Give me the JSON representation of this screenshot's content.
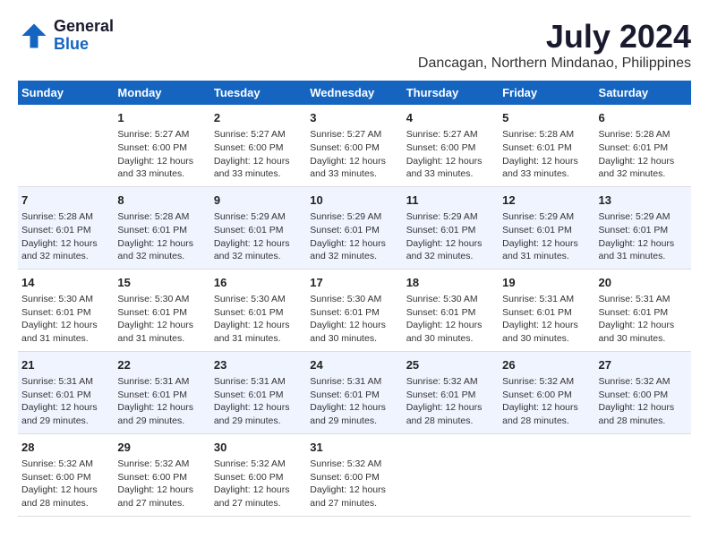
{
  "logo": {
    "line1": "General",
    "line2": "Blue"
  },
  "title": "July 2024",
  "subtitle": "Dancagan, Northern Mindanao, Philippines",
  "weekdays": [
    "Sunday",
    "Monday",
    "Tuesday",
    "Wednesday",
    "Thursday",
    "Friday",
    "Saturday"
  ],
  "weeks": [
    [
      {
        "day": "",
        "sunrise": "",
        "sunset": "",
        "daylight": ""
      },
      {
        "day": "1",
        "sunrise": "Sunrise: 5:27 AM",
        "sunset": "Sunset: 6:00 PM",
        "daylight": "Daylight: 12 hours and 33 minutes."
      },
      {
        "day": "2",
        "sunrise": "Sunrise: 5:27 AM",
        "sunset": "Sunset: 6:00 PM",
        "daylight": "Daylight: 12 hours and 33 minutes."
      },
      {
        "day": "3",
        "sunrise": "Sunrise: 5:27 AM",
        "sunset": "Sunset: 6:00 PM",
        "daylight": "Daylight: 12 hours and 33 minutes."
      },
      {
        "day": "4",
        "sunrise": "Sunrise: 5:27 AM",
        "sunset": "Sunset: 6:00 PM",
        "daylight": "Daylight: 12 hours and 33 minutes."
      },
      {
        "day": "5",
        "sunrise": "Sunrise: 5:28 AM",
        "sunset": "Sunset: 6:01 PM",
        "daylight": "Daylight: 12 hours and 33 minutes."
      },
      {
        "day": "6",
        "sunrise": "Sunrise: 5:28 AM",
        "sunset": "Sunset: 6:01 PM",
        "daylight": "Daylight: 12 hours and 32 minutes."
      }
    ],
    [
      {
        "day": "7",
        "sunrise": "Sunrise: 5:28 AM",
        "sunset": "Sunset: 6:01 PM",
        "daylight": "Daylight: 12 hours and 32 minutes."
      },
      {
        "day": "8",
        "sunrise": "Sunrise: 5:28 AM",
        "sunset": "Sunset: 6:01 PM",
        "daylight": "Daylight: 12 hours and 32 minutes."
      },
      {
        "day": "9",
        "sunrise": "Sunrise: 5:29 AM",
        "sunset": "Sunset: 6:01 PM",
        "daylight": "Daylight: 12 hours and 32 minutes."
      },
      {
        "day": "10",
        "sunrise": "Sunrise: 5:29 AM",
        "sunset": "Sunset: 6:01 PM",
        "daylight": "Daylight: 12 hours and 32 minutes."
      },
      {
        "day": "11",
        "sunrise": "Sunrise: 5:29 AM",
        "sunset": "Sunset: 6:01 PM",
        "daylight": "Daylight: 12 hours and 32 minutes."
      },
      {
        "day": "12",
        "sunrise": "Sunrise: 5:29 AM",
        "sunset": "Sunset: 6:01 PM",
        "daylight": "Daylight: 12 hours and 31 minutes."
      },
      {
        "day": "13",
        "sunrise": "Sunrise: 5:29 AM",
        "sunset": "Sunset: 6:01 PM",
        "daylight": "Daylight: 12 hours and 31 minutes."
      }
    ],
    [
      {
        "day": "14",
        "sunrise": "Sunrise: 5:30 AM",
        "sunset": "Sunset: 6:01 PM",
        "daylight": "Daylight: 12 hours and 31 minutes."
      },
      {
        "day": "15",
        "sunrise": "Sunrise: 5:30 AM",
        "sunset": "Sunset: 6:01 PM",
        "daylight": "Daylight: 12 hours and 31 minutes."
      },
      {
        "day": "16",
        "sunrise": "Sunrise: 5:30 AM",
        "sunset": "Sunset: 6:01 PM",
        "daylight": "Daylight: 12 hours and 31 minutes."
      },
      {
        "day": "17",
        "sunrise": "Sunrise: 5:30 AM",
        "sunset": "Sunset: 6:01 PM",
        "daylight": "Daylight: 12 hours and 30 minutes."
      },
      {
        "day": "18",
        "sunrise": "Sunrise: 5:30 AM",
        "sunset": "Sunset: 6:01 PM",
        "daylight": "Daylight: 12 hours and 30 minutes."
      },
      {
        "day": "19",
        "sunrise": "Sunrise: 5:31 AM",
        "sunset": "Sunset: 6:01 PM",
        "daylight": "Daylight: 12 hours and 30 minutes."
      },
      {
        "day": "20",
        "sunrise": "Sunrise: 5:31 AM",
        "sunset": "Sunset: 6:01 PM",
        "daylight": "Daylight: 12 hours and 30 minutes."
      }
    ],
    [
      {
        "day": "21",
        "sunrise": "Sunrise: 5:31 AM",
        "sunset": "Sunset: 6:01 PM",
        "daylight": "Daylight: 12 hours and 29 minutes."
      },
      {
        "day": "22",
        "sunrise": "Sunrise: 5:31 AM",
        "sunset": "Sunset: 6:01 PM",
        "daylight": "Daylight: 12 hours and 29 minutes."
      },
      {
        "day": "23",
        "sunrise": "Sunrise: 5:31 AM",
        "sunset": "Sunset: 6:01 PM",
        "daylight": "Daylight: 12 hours and 29 minutes."
      },
      {
        "day": "24",
        "sunrise": "Sunrise: 5:31 AM",
        "sunset": "Sunset: 6:01 PM",
        "daylight": "Daylight: 12 hours and 29 minutes."
      },
      {
        "day": "25",
        "sunrise": "Sunrise: 5:32 AM",
        "sunset": "Sunset: 6:01 PM",
        "daylight": "Daylight: 12 hours and 28 minutes."
      },
      {
        "day": "26",
        "sunrise": "Sunrise: 5:32 AM",
        "sunset": "Sunset: 6:00 PM",
        "daylight": "Daylight: 12 hours and 28 minutes."
      },
      {
        "day": "27",
        "sunrise": "Sunrise: 5:32 AM",
        "sunset": "Sunset: 6:00 PM",
        "daylight": "Daylight: 12 hours and 28 minutes."
      }
    ],
    [
      {
        "day": "28",
        "sunrise": "Sunrise: 5:32 AM",
        "sunset": "Sunset: 6:00 PM",
        "daylight": "Daylight: 12 hours and 28 minutes."
      },
      {
        "day": "29",
        "sunrise": "Sunrise: 5:32 AM",
        "sunset": "Sunset: 6:00 PM",
        "daylight": "Daylight: 12 hours and 27 minutes."
      },
      {
        "day": "30",
        "sunrise": "Sunrise: 5:32 AM",
        "sunset": "Sunset: 6:00 PM",
        "daylight": "Daylight: 12 hours and 27 minutes."
      },
      {
        "day": "31",
        "sunrise": "Sunrise: 5:32 AM",
        "sunset": "Sunset: 6:00 PM",
        "daylight": "Daylight: 12 hours and 27 minutes."
      },
      {
        "day": "",
        "sunrise": "",
        "sunset": "",
        "daylight": ""
      },
      {
        "day": "",
        "sunrise": "",
        "sunset": "",
        "daylight": ""
      },
      {
        "day": "",
        "sunrise": "",
        "sunset": "",
        "daylight": ""
      }
    ]
  ]
}
